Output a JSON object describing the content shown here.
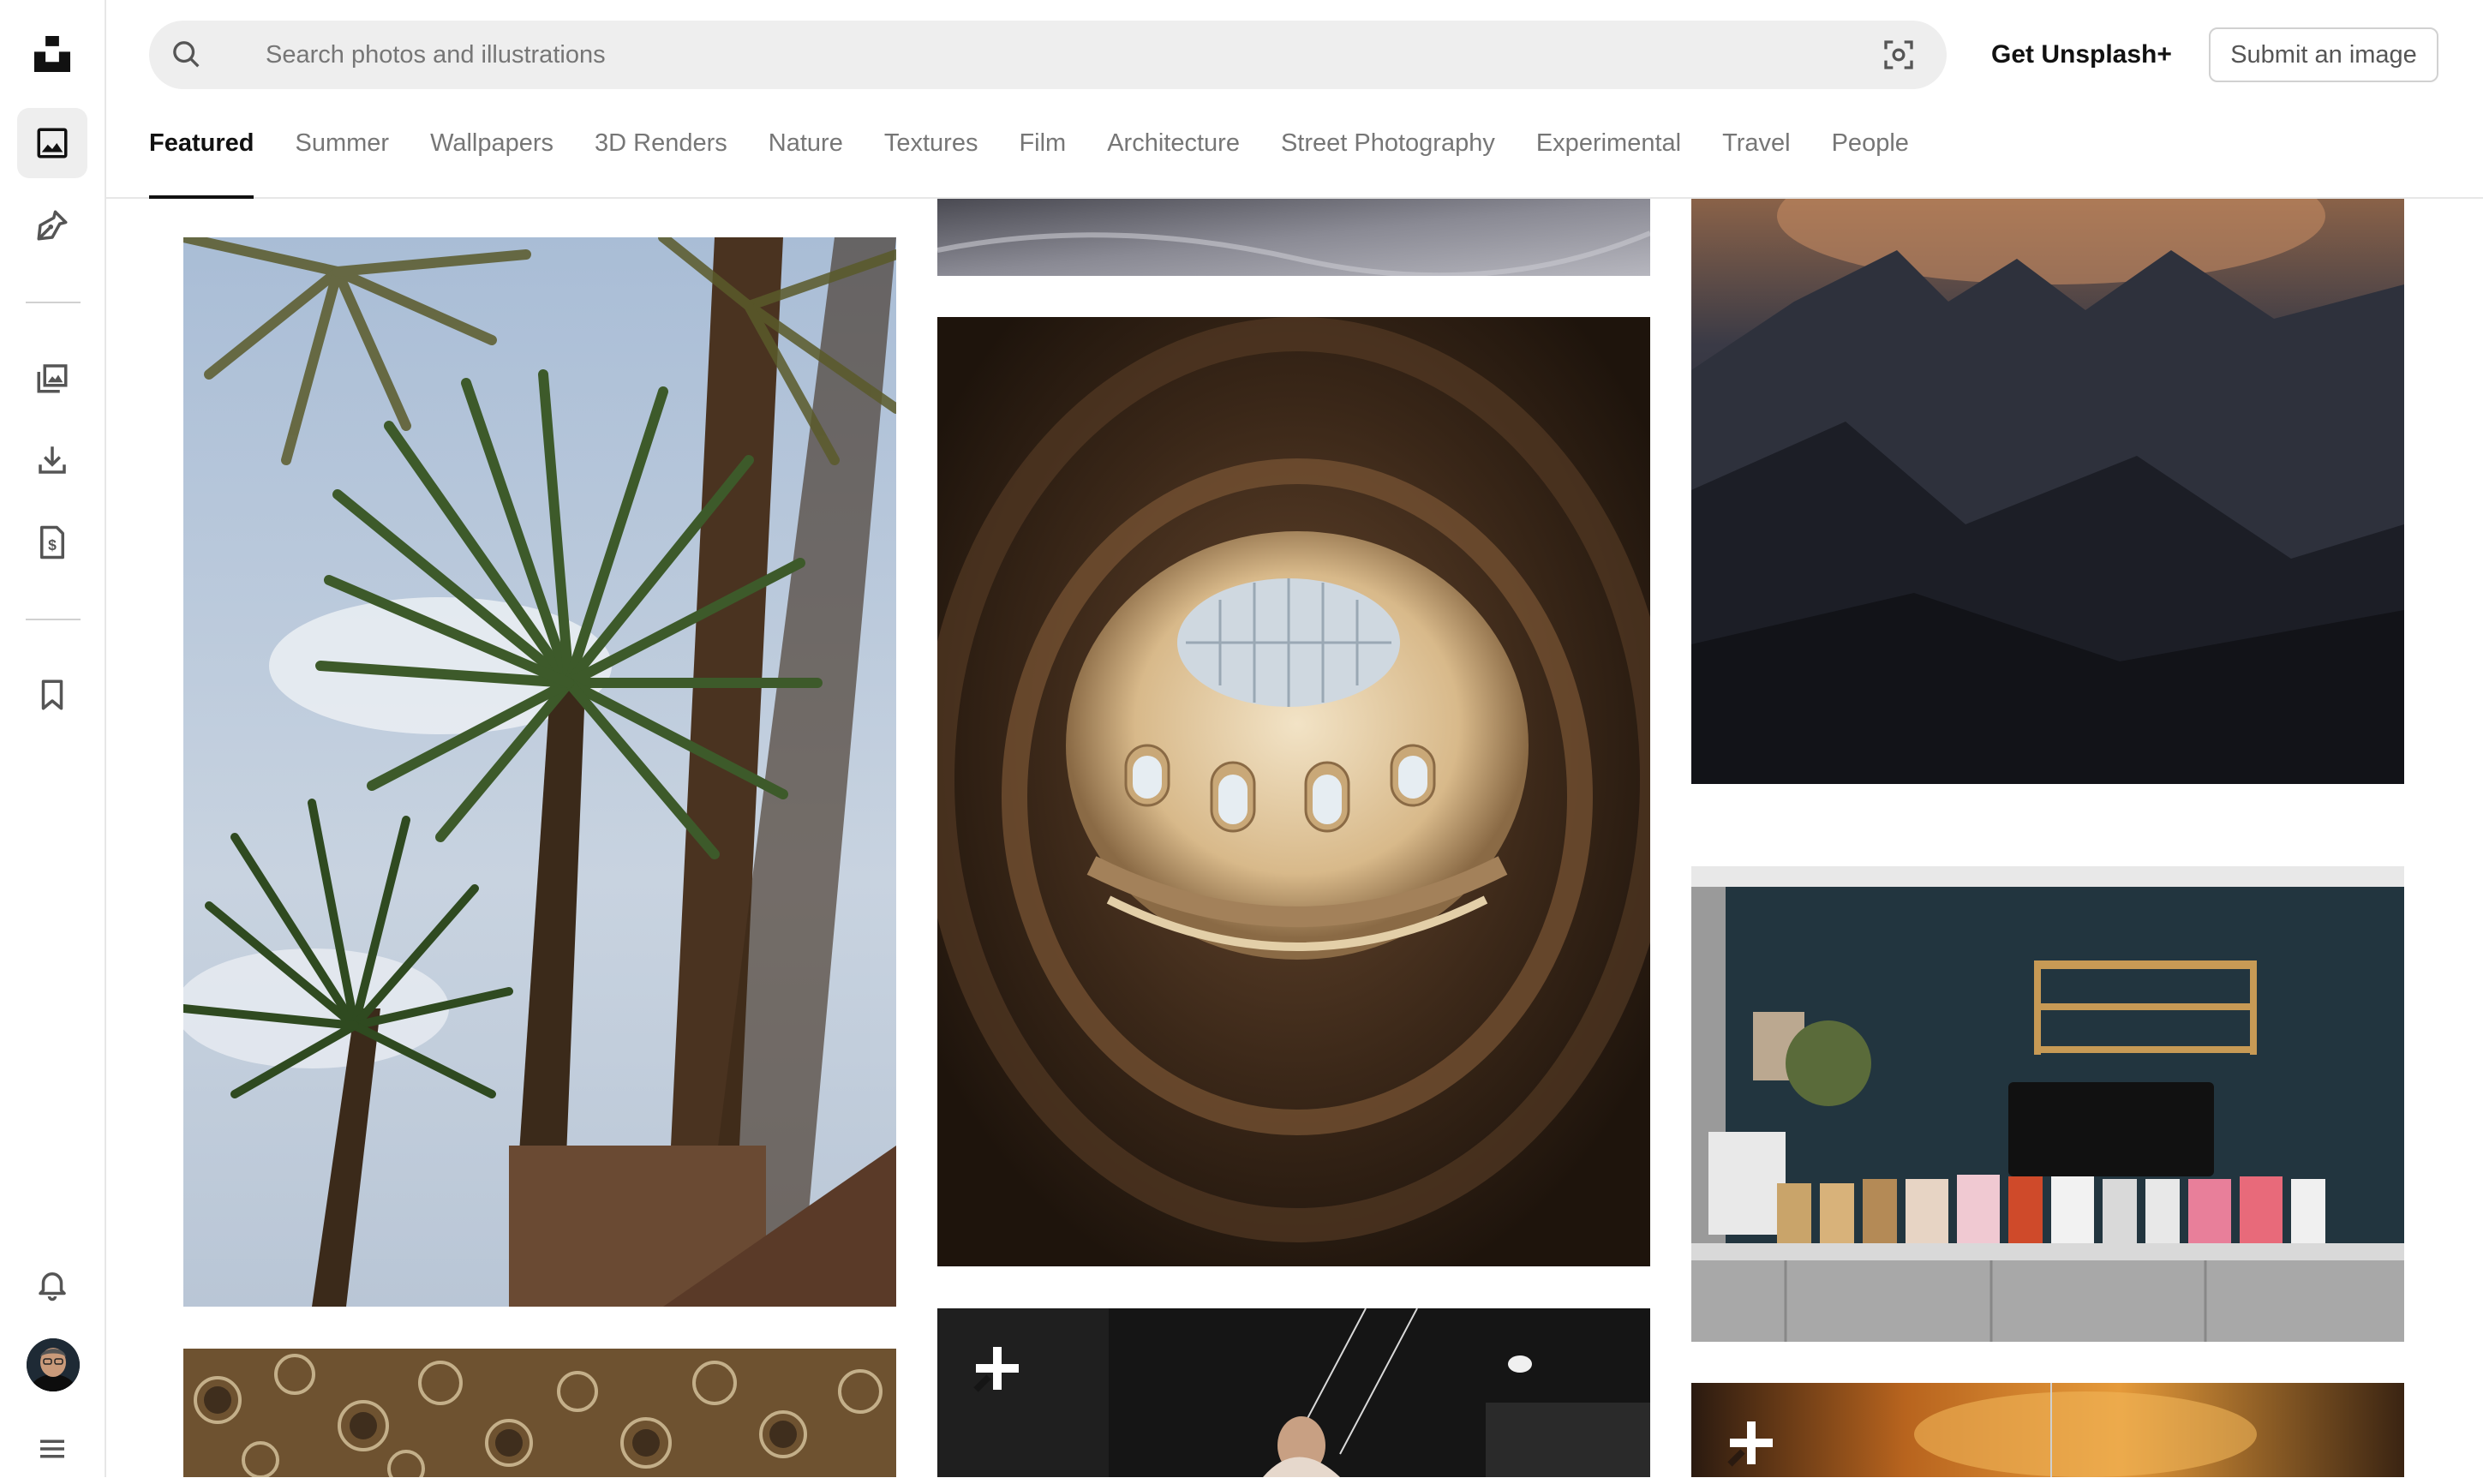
{
  "search": {
    "placeholder": "Search photos and illustrations"
  },
  "header": {
    "get_plus_label": "Get Unsplash+",
    "submit_label": "Submit an image"
  },
  "tabs": [
    {
      "label": "Featured",
      "active": true
    },
    {
      "label": "Summer"
    },
    {
      "label": "Wallpapers"
    },
    {
      "label": "3D Renders"
    },
    {
      "label": "Nature"
    },
    {
      "label": "Textures"
    },
    {
      "label": "Film"
    },
    {
      "label": "Architecture"
    },
    {
      "label": "Street Photography"
    },
    {
      "label": "Experimental"
    },
    {
      "label": "Travel"
    },
    {
      "label": "People"
    }
  ],
  "sidebar": {
    "items": [
      {
        "icon": "unsplash-logo-icon"
      },
      {
        "icon": "photos-icon",
        "active": true
      },
      {
        "icon": "illustrations-pen-icon"
      },
      {
        "icon": "collections-icon"
      },
      {
        "icon": "download-icon"
      },
      {
        "icon": "license-document-icon"
      },
      {
        "icon": "bookmark-icon"
      },
      {
        "icon": "bell-icon"
      },
      {
        "icon": "user-avatar"
      },
      {
        "icon": "menu-icon"
      }
    ]
  },
  "photos": [
    {
      "subject": "palm trees against sky"
    },
    {
      "subject": "glitter bokeh"
    },
    {
      "subject": "fabric"
    },
    {
      "subject": "ornate dome ceiling"
    },
    {
      "subject": "gym cable workout",
      "plus": true
    },
    {
      "subject": "dark mountains at dusk"
    },
    {
      "subject": "coffee shop counter"
    },
    {
      "subject": "orange smoke",
      "plus": true
    }
  ],
  "colors": {
    "accent": "#111111",
    "muted": "#767676",
    "search_bg": "#eeeeee",
    "border": "#d1d1d1"
  }
}
